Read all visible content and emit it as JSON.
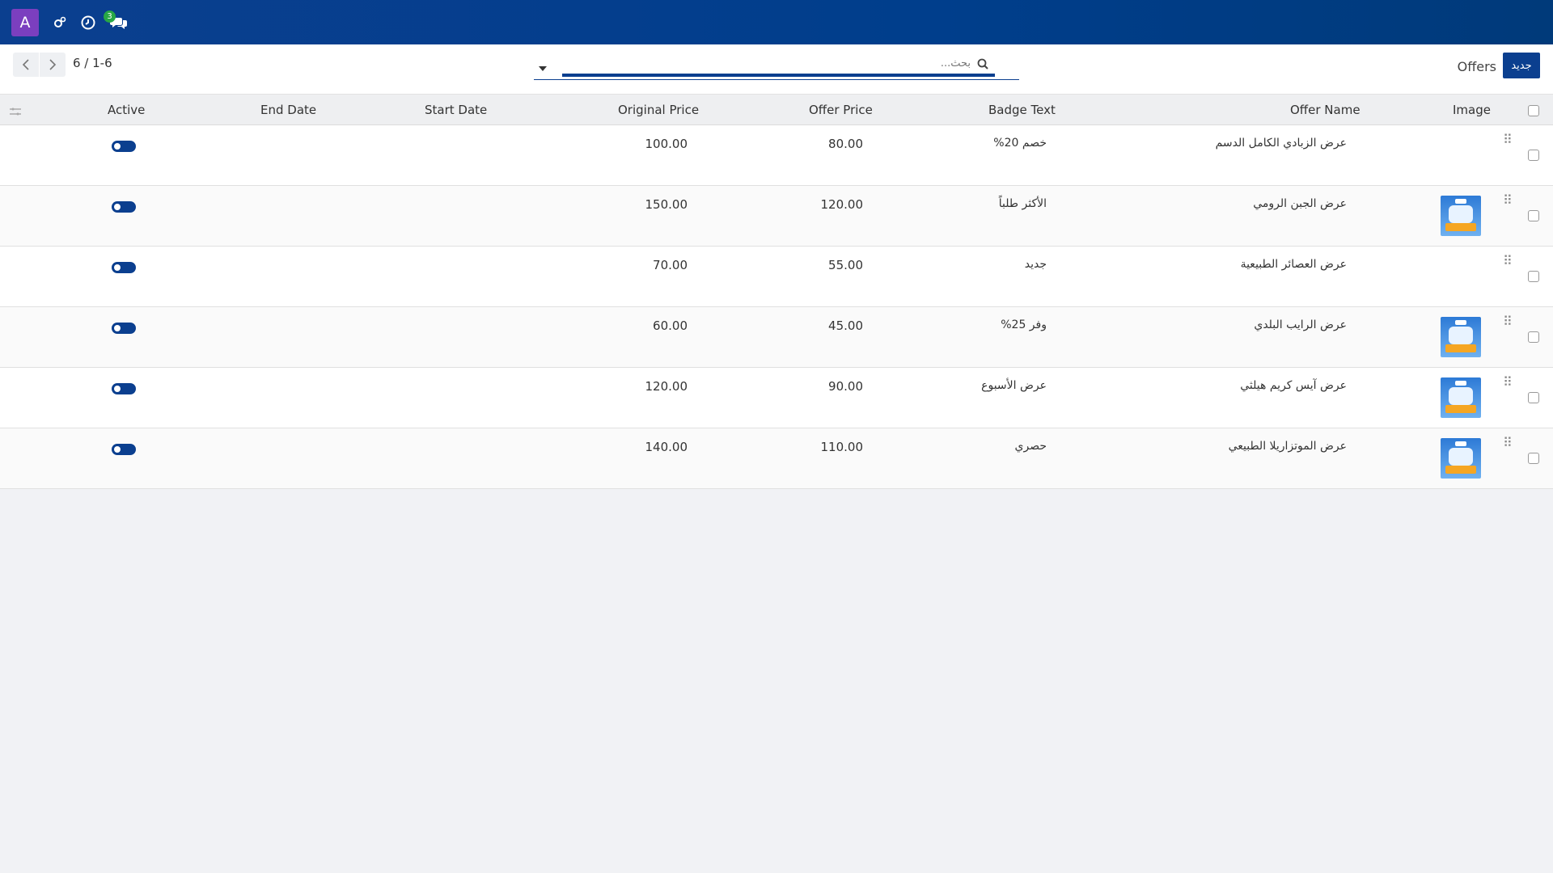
{
  "navbar": {
    "avatar_letter": "A",
    "icons": [
      "settings-gears-icon",
      "clock-icon",
      "chat-icon"
    ],
    "chat_badge": "3",
    "background": "#0b3f8f"
  },
  "control": {
    "pager": "6 / 1-6",
    "search_placeholder": "بحث...",
    "breadcrumb": "Offers",
    "new_button": "جديد",
    "accent": "#0b3f8f"
  },
  "table": {
    "columns": {
      "image": "Image",
      "offer_name": "Offer Name",
      "badge_text": "Badge Text",
      "offer_price": "Offer Price",
      "original_price": "Original Price",
      "start_date": "Start Date",
      "end_date": "End Date",
      "active": "Active"
    },
    "rows": [
      {
        "offer_name": "عرض الزبادي الكامل الدسم",
        "badge_text": "خصم 20%",
        "offer_price": "80.00",
        "original_price": "100.00",
        "start_date": "",
        "end_date": "",
        "active": true,
        "has_image": false
      },
      {
        "offer_name": "عرض الجبن الرومي",
        "badge_text": "الأكثر طلباً",
        "offer_price": "120.00",
        "original_price": "150.00",
        "start_date": "",
        "end_date": "",
        "active": true,
        "has_image": true
      },
      {
        "offer_name": "عرض العصائر الطبيعية",
        "badge_text": "جديد",
        "offer_price": "55.00",
        "original_price": "70.00",
        "start_date": "",
        "end_date": "",
        "active": true,
        "has_image": false
      },
      {
        "offer_name": "عرض الرايب البلدي",
        "badge_text": "وفر 25%",
        "offer_price": "45.00",
        "original_price": "60.00",
        "start_date": "",
        "end_date": "",
        "active": true,
        "has_image": true
      },
      {
        "offer_name": "عرض آيس كريم هيلثي",
        "badge_text": "عرض الأسبوع",
        "offer_price": "90.00",
        "original_price": "120.00",
        "start_date": "",
        "end_date": "",
        "active": true,
        "has_image": true
      },
      {
        "offer_name": "عرض الموتزاريلا الطبيعي",
        "badge_text": "حصري",
        "offer_price": "110.00",
        "original_price": "140.00",
        "start_date": "",
        "end_date": "",
        "active": true,
        "has_image": true
      }
    ]
  }
}
